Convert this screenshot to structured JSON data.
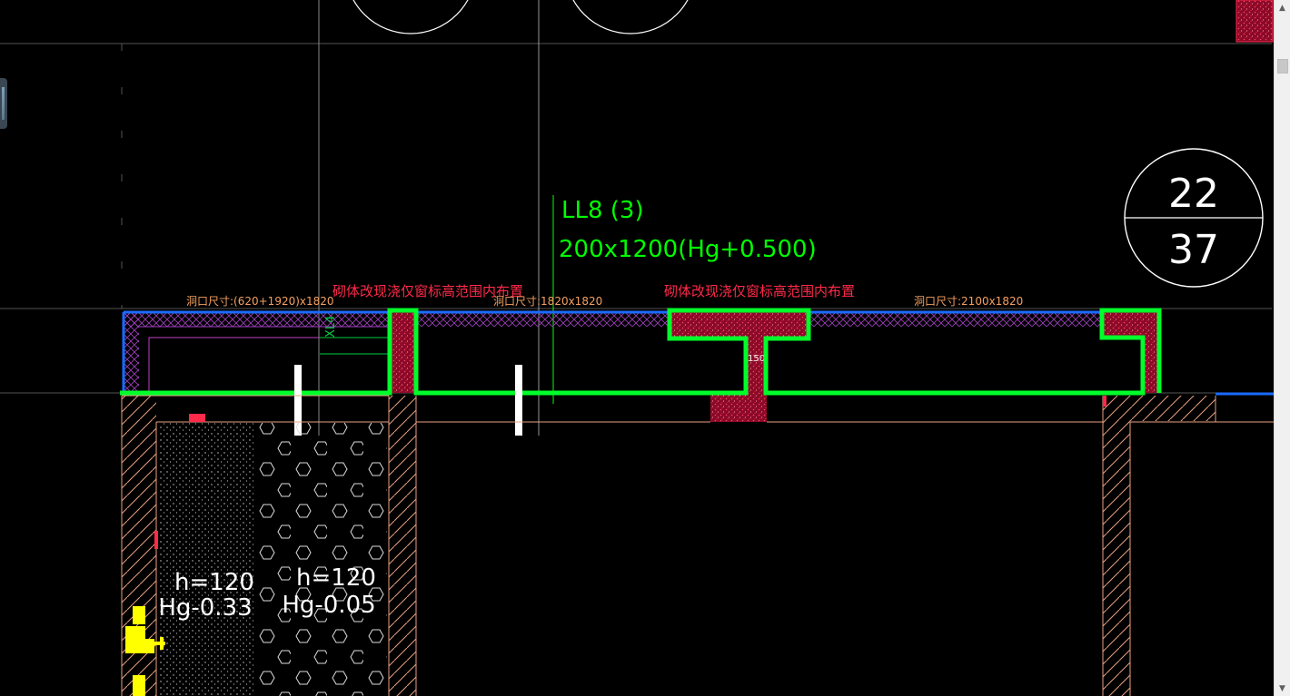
{
  "beam_label": {
    "code": "LL8 (3)",
    "spec": "200x1200(Hg+0.500)"
  },
  "axis_bubble": {
    "top": "22",
    "bottom": "37"
  },
  "notes": {
    "masonry_left": "砌体改现浇仅窗标高范围内布置",
    "masonry_right": "砌体改现浇仅窗标高范围内布置"
  },
  "openings": {
    "left": "洞口尺寸:(620+1920)x1820",
    "middle": "洞口尺寸:1820x1820",
    "right": "洞口尺寸:2100x1820"
  },
  "slabs": {
    "left": {
      "thickness": "h=120",
      "elevation": "Hg-0.33"
    },
    "right": {
      "thickness": "h=120",
      "elevation": "Hg-0.05"
    }
  },
  "dimension_150": "150",
  "xl_tag": "XL4",
  "colors": {
    "background": "#000000",
    "wall_blue": "#1a6bff",
    "highlight_green": "#00ff2a",
    "beam_label": "#00ff00",
    "note_red": "#ff2a4a",
    "opening_text": "#f4a060",
    "hatch_brown": "#e8a080",
    "concrete_red": "#c8103a",
    "slab_white": "#ffffff",
    "yellow_mark": "#ffff00",
    "magenta_line": "#c040c0"
  }
}
